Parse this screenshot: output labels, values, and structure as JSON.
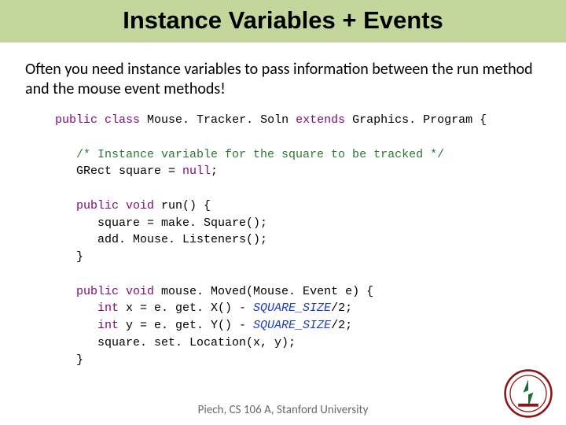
{
  "title": "Instance Variables + Events",
  "paragraph": "Often you need instance variables to pass information between the run method and the mouse event methods!",
  "code": {
    "l1a": "public",
    "l1b": "class",
    "l1c": " Mouse. Tracker. Soln ",
    "l1d": "extends",
    "l1e": " Graphics. Program {",
    "l2": "   /* Instance variable for the square to be tracked */",
    "l3a": "   GRect square = ",
    "l3b": "null",
    "l3c": ";",
    "l4a": "   public",
    "l4b": " void",
    "l4c": " run() {",
    "l5": "      square = make. Square();",
    "l6": "      add. Mouse. Listeners();",
    "l7": "   }",
    "l8a": "   public",
    "l8b": " void",
    "l8c": " mouse. Moved(Mouse. Event e) {",
    "l9a": "      int",
    "l9b": " x = e. get. X() - ",
    "l9c": "SQUARE_SIZE",
    "l9d": "/2;",
    "l10a": "      int",
    "l10b": " y = e. get. Y() - ",
    "l10c": "SQUARE_SIZE",
    "l10d": "/2;",
    "l11": "      square. set. Location(x, y);",
    "l12": "   }"
  },
  "footer": "Piech, CS 106 A, Stanford University"
}
